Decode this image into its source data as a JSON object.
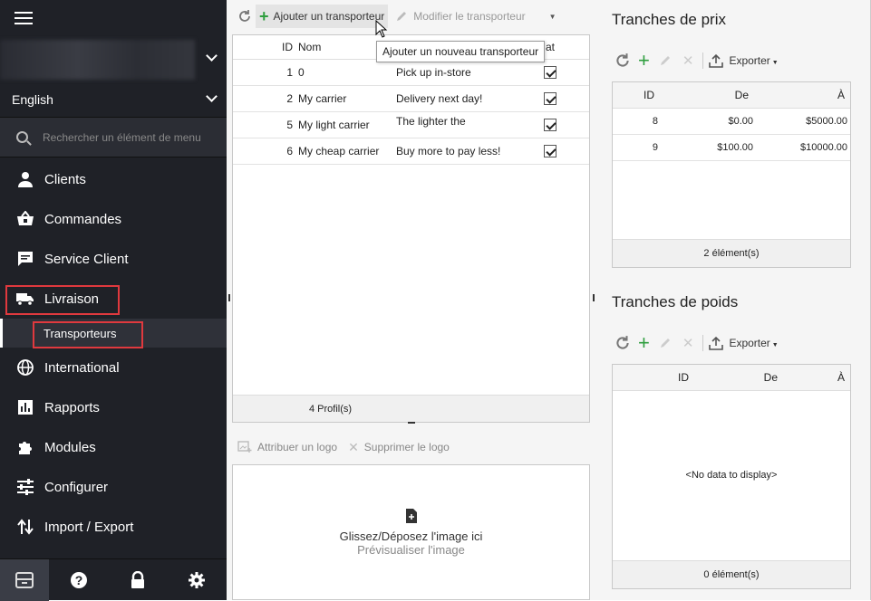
{
  "sidebar": {
    "language": "English",
    "search_placeholder": "Rechercher un élément de menu",
    "items": [
      {
        "label": "Clients",
        "icon": "user-icon"
      },
      {
        "label": "Commandes",
        "icon": "basket-icon"
      },
      {
        "label": "Service Client",
        "icon": "chat-icon"
      },
      {
        "label": "Livraison",
        "icon": "truck-icon"
      },
      {
        "label": "International",
        "icon": "globe-icon"
      },
      {
        "label": "Rapports",
        "icon": "bar-chart-icon"
      },
      {
        "label": "Modules",
        "icon": "puzzle-icon"
      },
      {
        "label": "Configurer",
        "icon": "sliders-icon"
      },
      {
        "label": "Import / Export",
        "icon": "import-export-icon"
      }
    ],
    "sub_item": "Transporteurs",
    "highlight_color": "#e0393e"
  },
  "carriers": {
    "toolbar": {
      "add_label": "Ajouter un transporteur",
      "edit_label": "Modifier le transporteur"
    },
    "tooltip": "Ajouter un nouveau transporteur",
    "columns": {
      "id": "ID",
      "nom": "Nom",
      "etat": "at"
    },
    "rows": [
      {
        "id": "1",
        "nom": "0",
        "delai": "Pick up in-store",
        "checked": true
      },
      {
        "id": "2",
        "nom": "My carrier",
        "delai": "Delivery next day!",
        "checked": true
      },
      {
        "id": "5",
        "nom": "My light carrier",
        "delai": "The lighter the",
        "checked": true
      },
      {
        "id": "6",
        "nom": "My cheap carrier",
        "delai": "Buy more to pay less!",
        "checked": true
      }
    ],
    "footer": "4 Profil(s)",
    "logo_toolbar": {
      "assign": "Attribuer un logo",
      "delete": "Supprimer le logo"
    },
    "dropzone": {
      "title": "Glissez/Déposez l'image ici",
      "subtitle": "Prévisualiser l'image"
    }
  },
  "price_ranges": {
    "title": "Tranches de prix",
    "export_label": "Exporter",
    "columns": {
      "id": "ID",
      "de": "De",
      "a": "À"
    },
    "rows": [
      {
        "id": "8",
        "de": "$0.00",
        "a": "$5000.00"
      },
      {
        "id": "9",
        "de": "$100.00",
        "a": "$10000.00"
      }
    ],
    "footer": "2 élément(s)"
  },
  "weight_ranges": {
    "title": "Tranches de poids",
    "export_label": "Exporter",
    "columns": {
      "id": "ID",
      "de": "De",
      "a": "À"
    },
    "empty": "<No data to display>",
    "footer": "0 élément(s)"
  }
}
